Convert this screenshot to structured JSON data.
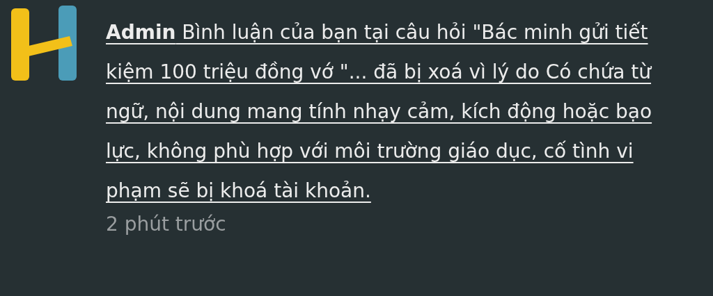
{
  "notification": {
    "message": "**Admin** Bình luận của bạn tại câu hỏi \"Bác minh gửi tiết kiệm 100 triệu đồng vớ \"... đã bị xoá vì lý do Có chứa từ ngữ, nội dung mang tính nhạy cảm, kích động hoặc bạo lực, không phù hợp với môi trường giáo dục, cố tình vi phạm sẽ bị khoá tài khoản.",
    "time": "2 phút trước"
  }
}
